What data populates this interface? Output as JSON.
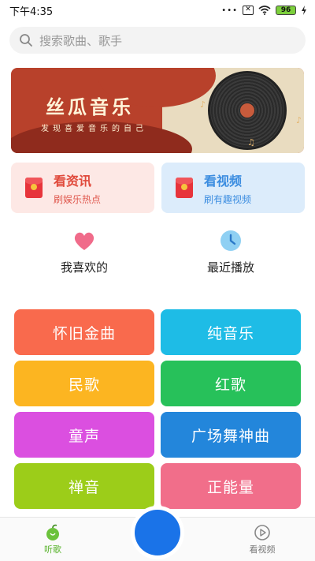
{
  "status_bar": {
    "time": "下午4:35",
    "battery": "96"
  },
  "search": {
    "placeholder": "搜索歌曲、歌手"
  },
  "banner": {
    "title": "丝瓜音乐",
    "subtitle": "发现喜爱音乐的自己"
  },
  "cards": [
    {
      "title": "看资讯",
      "subtitle": "刷娱乐热点"
    },
    {
      "title": "看视频",
      "subtitle": "刷有趣视频"
    }
  ],
  "quick": {
    "favorites": "我喜欢的",
    "recent": "最近播放"
  },
  "categories": [
    {
      "label": "怀旧金曲",
      "color": "#f96a4d"
    },
    {
      "label": "纯音乐",
      "color": "#1ebce6"
    },
    {
      "label": "民歌",
      "color": "#fcb521"
    },
    {
      "label": "红歌",
      "color": "#27c15a"
    },
    {
      "label": "童声",
      "color": "#db4fe0"
    },
    {
      "label": "广场舞神曲",
      "color": "#2386db"
    },
    {
      "label": "禅音",
      "color": "#9ccd19"
    },
    {
      "label": "正能量",
      "color": "#f16e8a"
    }
  ],
  "nav": {
    "listen": "听歌",
    "video": "看视频"
  },
  "colors": {
    "accent_green": "#58b32c",
    "fab_blue": "#1a73e8"
  }
}
